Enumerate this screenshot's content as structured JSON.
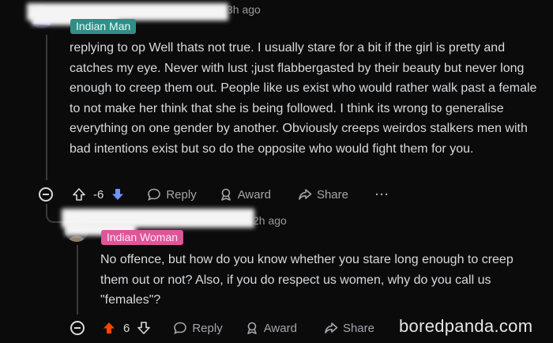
{
  "comments": [
    {
      "time": "3h ago",
      "flair": "Indian Man",
      "flair_bg": "#2f8f86",
      "flair_color": "#e8fbf8",
      "body": "replying to op Well thats not true. I usually stare for a bit if the girl is pretty and catches my eye. Never with lust ;just flabbergasted by their beauty but never long enough to creep them out. People like us exist who would rather walk past a female to not make her think that she is being followed. I think its wrong to generalise everything on one gender by another. Obviously creeps weirdos stalkers men with bad intentions exist but so do the opposite who would fight them for you.",
      "score": "-6",
      "vote_state": "downvoted",
      "reply_label": "Reply",
      "award_label": "Award",
      "share_label": "Share",
      "more_label": "···"
    },
    {
      "time": "2h ago",
      "flair": "Indian Woman",
      "flair_bg": "#e0559a",
      "flair_color": "#fde9f3",
      "body": "No offence, but how do you know whether you stare long enough to creep them out or not? Also, if you do respect us women, why do you call us \"females\"?",
      "score": "6",
      "vote_state": "upvoted",
      "reply_label": "Reply",
      "award_label": "Award",
      "share_label": "Share"
    }
  ],
  "colors": {
    "upvote": "#ff4500",
    "downvote": "#7193ff",
    "bg": "#0b0b0c",
    "text": "#d7dadc",
    "muted": "#a6a6ab"
  },
  "watermark": "boredpanda.com"
}
